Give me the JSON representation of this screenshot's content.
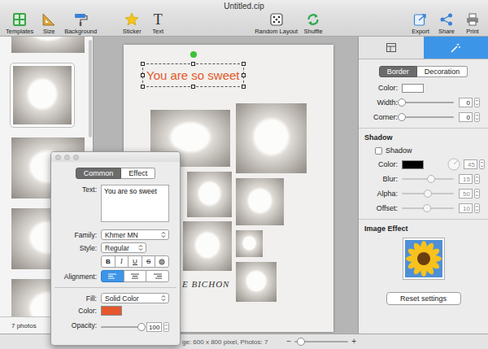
{
  "window": {
    "title": "Untitled.cip"
  },
  "toolbar": {
    "groups": [
      [
        {
          "label": "Templates"
        },
        {
          "label": "Size"
        },
        {
          "label": "Background"
        }
      ],
      [
        {
          "label": "Sticker"
        },
        {
          "label": "Text",
          "glyph": "T"
        }
      ],
      [
        {
          "label": "Random Layout"
        },
        {
          "label": "Shuffle"
        }
      ],
      [
        {
          "label": "Export"
        },
        {
          "label": "Share"
        },
        {
          "label": "Print"
        }
      ]
    ]
  },
  "sidebar": {
    "thumbnails": [
      {
        "selected": false
      },
      {
        "selected": true
      },
      {
        "selected": false
      },
      {
        "selected": false
      },
      {
        "selected": false
      }
    ],
    "count": "7 photos"
  },
  "page": {
    "title_selected": true,
    "caption": "E BICHON"
  },
  "right_panel": {
    "tabs": [
      {
        "kind": "layout",
        "selected": false
      },
      {
        "kind": "effects",
        "selected": true
      }
    ],
    "segments": [
      {
        "label": "Border",
        "selected": true
      },
      {
        "label": "Decoration",
        "selected": false
      }
    ],
    "border_rows": [
      {
        "kind": "color",
        "label": "Color:",
        "swatch": "#ffffff",
        "disabled": false
      },
      {
        "kind": "slider",
        "label": "Width:",
        "level": 0,
        "value": "0",
        "disabled": false
      },
      {
        "kind": "slider",
        "label": "Corner:",
        "level": 0,
        "value": "0",
        "disabled": false
      }
    ],
    "shadow": {
      "heading": "Shadow",
      "checkbox": {
        "label": "Shadow",
        "checked": false
      },
      "rows": [
        {
          "kind": "color",
          "label": "Color:",
          "swatch": "#000000",
          "value": "45",
          "disabled": true
        },
        {
          "kind": "slider",
          "label": "Blur:",
          "level": 0.57,
          "value": "15",
          "disabled": true
        },
        {
          "kind": "slider",
          "label": "Alpha:",
          "level": 0.5,
          "value": "50",
          "disabled": true
        },
        {
          "kind": "slider",
          "label": "Offset:",
          "level": 0.48,
          "value": "10",
          "disabled": true
        }
      ]
    },
    "image_effect": {
      "heading": "Image Effect"
    },
    "reset_button": {
      "label": "Reset settings"
    }
  },
  "status_bar": {
    "text": "ge: 600 x 800 pixel, Photos: 7",
    "zoom": {
      "minus": "−",
      "plus": "+",
      "level": 0.12
    }
  },
  "text_panel": {
    "tabs": [
      {
        "label": "Common",
        "selected": true
      },
      {
        "label": "Effect",
        "selected": false
      }
    ],
    "text": {
      "label": "Text:",
      "value": "You are so sweet"
    },
    "family": {
      "label": "Family:",
      "value": "Khmer MN"
    },
    "style": {
      "label": "Style:",
      "value": "Regular"
    },
    "format_buttons": [
      {
        "kind": "bold",
        "label": "B"
      },
      {
        "kind": "italic",
        "label": "I"
      },
      {
        "kind": "underline",
        "label": "U"
      },
      {
        "kind": "strike",
        "label": "S"
      },
      {
        "kind": "outline"
      }
    ],
    "alignment": {
      "label": "Alignment:",
      "options": [
        {
          "kind": "left",
          "selected": true
        },
        {
          "kind": "center",
          "selected": false
        },
        {
          "kind": "right",
          "selected": false
        }
      ]
    },
    "fill": {
      "label": "Fill:",
      "value": "Solid Color"
    },
    "color": {
      "label": "Color:",
      "swatch": "#e4582c"
    },
    "opacity": {
      "label": "Opacity:",
      "level": 1,
      "value": "100"
    }
  }
}
